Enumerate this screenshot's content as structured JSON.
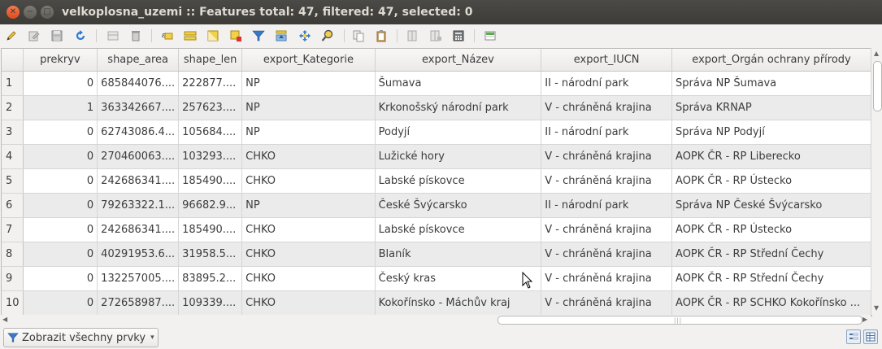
{
  "window": {
    "title": "velkoplosna_uzemi :: Features total: 47, filtered: 47, selected: 0",
    "close_glyph": "✕",
    "minimize_glyph": "−",
    "maximize_glyph": "□"
  },
  "toolbar": {
    "icons": [
      "toggle-editing-icon",
      "multi-edit-icon",
      "save-edits-icon",
      "reload-icon",
      "add-feature-icon",
      "delete-feature-icon",
      "select-by-expression-icon",
      "select-all-icon",
      "invert-selection-icon",
      "deselect-all-icon",
      "filter-select-icon",
      "move-selection-top-icon",
      "pan-to-selection-icon",
      "zoom-to-selection-icon",
      "copy-rows-icon",
      "paste-features-icon",
      "new-field-icon",
      "delete-field-icon",
      "open-field-calculator-icon",
      "conditional-formatting-icon"
    ]
  },
  "table": {
    "columns": [
      "prekryv",
      "shape_area",
      "shape_len",
      "export_Kategorie",
      "export_Název",
      "export_IUCN",
      "export_Orgán ochrany přírody"
    ],
    "rows": [
      {
        "n": "1",
        "prekryv": "0",
        "shape_area": "685844076....",
        "shape_len": "222877....",
        "kategorie": "NP",
        "nazev": "Šumava",
        "iucn": "II - národní park",
        "organ": "Správa NP Šumava"
      },
      {
        "n": "2",
        "prekryv": "1",
        "shape_area": "363342667....",
        "shape_len": "257623....",
        "kategorie": "NP",
        "nazev": "Krkonošský národní park",
        "iucn": "V - chráněná krajina",
        "organ": "Správa KRNAP"
      },
      {
        "n": "3",
        "prekryv": "0",
        "shape_area": "62743086.4...",
        "shape_len": "105684....",
        "kategorie": "NP",
        "nazev": "Podyjí",
        "iucn": "II - národní park",
        "organ": "Správa NP Podyjí"
      },
      {
        "n": "4",
        "prekryv": "0",
        "shape_area": "270460063....",
        "shape_len": "103293....",
        "kategorie": "CHKO",
        "nazev": "Lužické hory",
        "iucn": "V - chráněná krajina",
        "organ": "AOPK ČR - RP Liberecko"
      },
      {
        "n": "5",
        "prekryv": "0",
        "shape_area": "242686341....",
        "shape_len": "185490....",
        "kategorie": "CHKO",
        "nazev": "Labské pískovce",
        "iucn": "V - chráněná krajina",
        "organ": "AOPK ČR - RP Ústecko"
      },
      {
        "n": "6",
        "prekryv": "0",
        "shape_area": "79263322.1...",
        "shape_len": "96682.9...",
        "kategorie": "NP",
        "nazev": "České Švýcarsko",
        "iucn": "II - národní park",
        "organ": "Správa NP České Švýcarsko"
      },
      {
        "n": "7",
        "prekryv": "0",
        "shape_area": "242686341....",
        "shape_len": "185490....",
        "kategorie": "CHKO",
        "nazev": "Labské pískovce",
        "iucn": "V - chráněná krajina",
        "organ": "AOPK ČR - RP Ústecko"
      },
      {
        "n": "8",
        "prekryv": "0",
        "shape_area": "40291953.6...",
        "shape_len": "31958.5...",
        "kategorie": "CHKO",
        "nazev": "Blaník",
        "iucn": "V - chráněná krajina",
        "organ": "AOPK ČR - RP Střední Čechy"
      },
      {
        "n": "9",
        "prekryv": "0",
        "shape_area": "132257005....",
        "shape_len": "83895.2...",
        "kategorie": "CHKO",
        "nazev": "Český kras",
        "iucn": "V - chráněná krajina",
        "organ": "AOPK ČR - RP Střední Čechy"
      },
      {
        "n": "10",
        "prekryv": "0",
        "shape_area": "272658987....",
        "shape_len": "109339....",
        "kategorie": "CHKO",
        "nazev": "Kokořínsko - Máchův kraj",
        "iucn": "V - chráněná krajina",
        "organ": "AOPK ČR - RP SCHKO Kokořínsko ..."
      }
    ]
  },
  "bottom": {
    "filter_label": "Zobrazit všechny prvky",
    "filter_caret": "▾"
  },
  "scrollbars": {
    "up_arrow": "▲",
    "down_arrow": "▼",
    "left_arrow": "◀",
    "right_arrow": "▶",
    "grip": "|||"
  },
  "colors": {
    "titlebar": "#3c3b37",
    "close_button": "#df4a16",
    "alt_row": "#ebebeb"
  }
}
